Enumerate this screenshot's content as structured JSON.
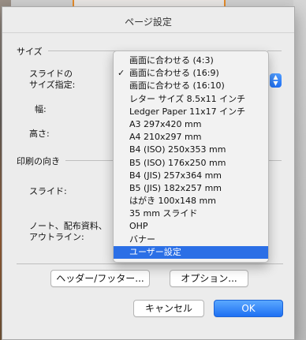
{
  "dialog": {
    "title": "ページ設定",
    "size_section": {
      "label": "サイズ",
      "slide_size_label": "スライドの\nサイズ指定:",
      "width_label": "幅:",
      "height_label": "高さ:"
    },
    "print_orientation_section": {
      "label": "印刷の向き",
      "slide_label": "スライド:",
      "notes_label": "ノート、配布資料、\nアウトライン:"
    },
    "buttons": {
      "header_footer": "ヘッダー/フッター...",
      "options": "オプション...",
      "cancel": "キャンセル",
      "ok": "OK"
    },
    "stepper_icon": "updown-chevrons-icon",
    "accent_color": "#2b6fe6"
  },
  "dropdown": {
    "checked_index": 1,
    "selected_index": 15,
    "items": [
      "画面に合わせる (4:3)",
      "画面に合わせる (16:9)",
      "画面に合わせる (16:10)",
      "レター サイズ 8.5x11 インチ",
      "Ledger Paper 11x17 インチ",
      "A3 297x420 mm",
      "A4 210x297 mm",
      "B4 (ISO) 250x353 mm",
      "B5 (ISO) 176x250 mm",
      "B4 (JIS) 257x364 mm",
      "B5 (JIS) 182x257 mm",
      "はがき 100x148 mm",
      "35 mm スライド",
      "OHP",
      "バナー",
      "ユーザー設定"
    ]
  }
}
